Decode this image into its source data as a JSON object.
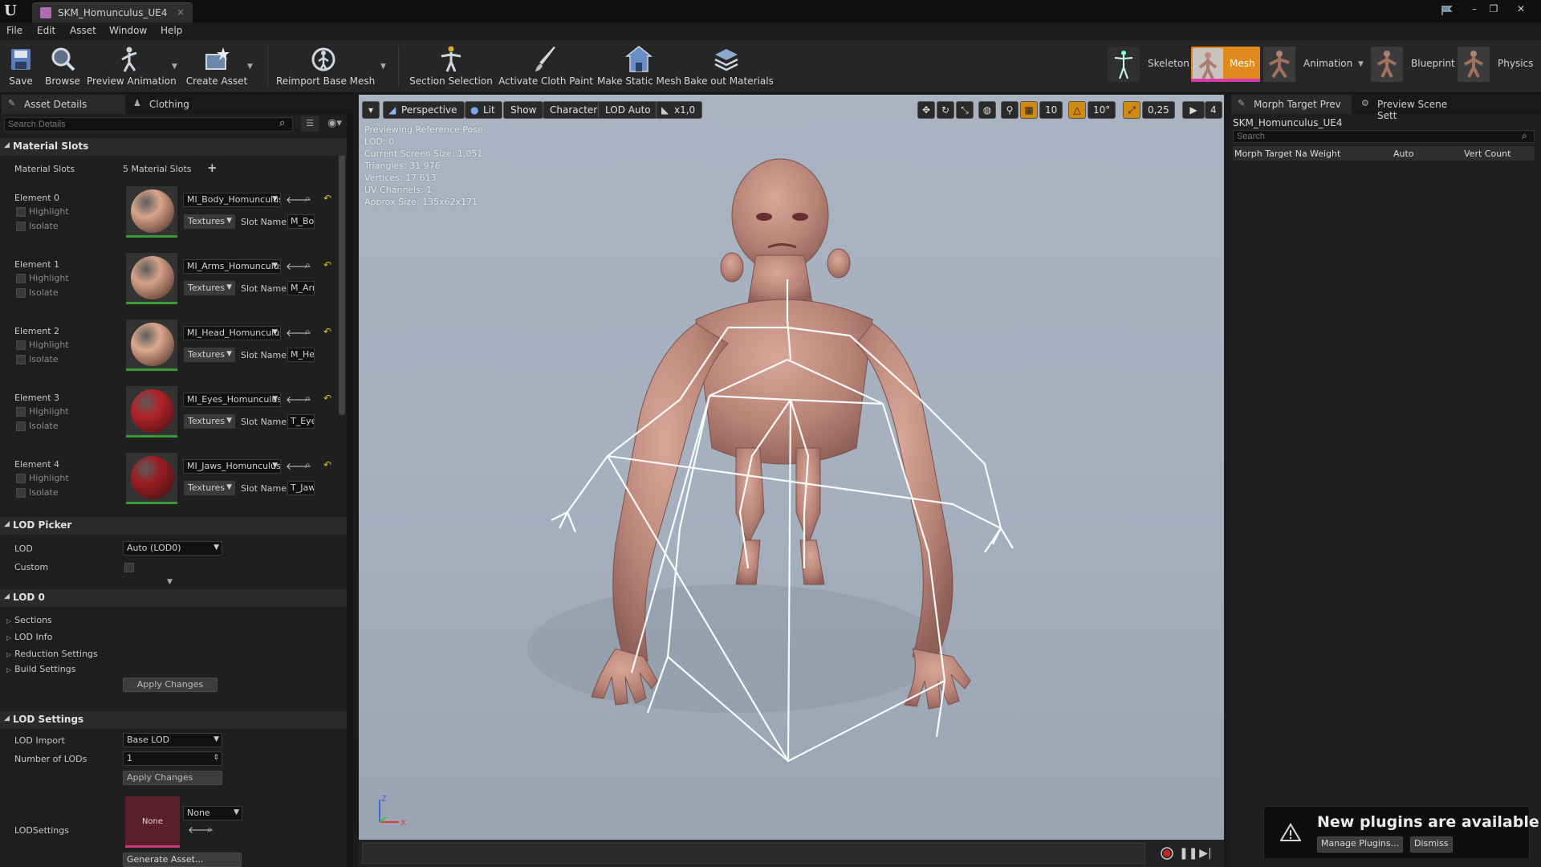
{
  "window": {
    "tab_title": "SKM_Homunculus_UE4",
    "tab_close": "×",
    "logo": "U",
    "controls": [
      "–",
      "❐",
      "✕"
    ],
    "flag_icon": "flag-icon"
  },
  "menu": [
    "File",
    "Edit",
    "Asset",
    "Window",
    "Help"
  ],
  "toolbar": {
    "buttons": [
      {
        "label": "Save",
        "icon": "save-icon"
      },
      {
        "label": "Browse",
        "icon": "browse-icon"
      },
      {
        "label": "Preview Animation",
        "icon": "preview-animation-icon"
      },
      {
        "label": "Create Asset",
        "icon": "create-asset-icon"
      },
      {
        "label": "Reimport Base Mesh",
        "icon": "reimport-icon"
      },
      {
        "label": "Section Selection",
        "icon": "section-selection-icon"
      },
      {
        "label": "Activate Cloth Paint",
        "icon": "cloth-paint-icon"
      },
      {
        "label": "Make Static Mesh",
        "icon": "static-mesh-icon"
      },
      {
        "label": "Bake out Materials",
        "icon": "bake-materials-icon"
      }
    ],
    "modes": [
      {
        "label": "Skeleton"
      },
      {
        "label": "Mesh",
        "active": true
      },
      {
        "label": "Animation"
      },
      {
        "label": "Blueprint"
      },
      {
        "label": "Physics"
      }
    ],
    "active_color": "#e08a1e"
  },
  "left_panel": {
    "tabs": [
      "Asset Details",
      "Clothing"
    ],
    "search_placeholder": "Search Details",
    "material_slots": {
      "header": "Material Slots",
      "label": "Material Slots",
      "count": "5 Material Slots",
      "add": "+",
      "highlight": "Highlight",
      "isolate": "Isolate",
      "textures": "Textures",
      "slot_name_label": "Slot Name",
      "elements": [
        {
          "name": "Element 0",
          "material": "MI_Body_Homunculus",
          "slot": "M_Body",
          "color": "#d8a58a"
        },
        {
          "name": "Element 1",
          "material": "MI_Arms_Homunculus",
          "slot": "M_Arms",
          "color": "#d6a288"
        },
        {
          "name": "Element 2",
          "material": "MI_Head_Homunculus",
          "slot": "M_Head",
          "color": "#dca98f"
        },
        {
          "name": "Element 3",
          "material": "MI_Eyes_Homunculus",
          "slot": "T_Eyes",
          "color": "#b3222a"
        },
        {
          "name": "Element 4",
          "material": "MI_Jaws_Homunculus",
          "slot": "T_Jaws",
          "color": "#9a1d22"
        }
      ]
    },
    "lod_picker": {
      "header": "LOD Picker",
      "lod_label": "LOD",
      "lod_value": "Auto (LOD0)",
      "custom_label": "Custom"
    },
    "lod0": {
      "header": "LOD 0",
      "items": [
        "Sections",
        "LOD Info",
        "Reduction Settings",
        "Build Settings"
      ],
      "apply": "Apply Changes"
    },
    "lod_settings": {
      "header": "LOD Settings",
      "lod_import_label": "LOD Import",
      "lod_import_value": "Base LOD",
      "num_lods_label": "Number of LODs",
      "num_lods_value": "1",
      "apply": "Apply Changes",
      "lodsettings_label": "LODSettings",
      "lodsettings_thumb": "None",
      "lodsettings_value": "None",
      "generate": "Generate Asset..."
    }
  },
  "viewport": {
    "menu_btn": "▾",
    "perspective": "Perspective",
    "lit": "Lit",
    "show": "Show",
    "character": "Character",
    "lod": "LOD Auto",
    "speed": "x1,0",
    "grid_snap": "10",
    "rot_snap": "10°",
    "scale_snap": "0,25",
    "cam_speed": "4",
    "stats": [
      "Previewing Reference Pose",
      "LOD: 0",
      "Current Screen Size: 1,051",
      "Triangles: 31 976",
      "Vertices: 17 613",
      "UV Channels: 1",
      "Approx Size: 135x62x171"
    ],
    "axis_z": "Z",
    "axis_x": "X",
    "bg_color": "#a8b2c1"
  },
  "right_panel": {
    "tabs": [
      "Morph Target Prev",
      "Preview Scene Sett"
    ],
    "mesh_name": "SKM_Homunculus_UE4",
    "search_placeholder": "Search",
    "columns": [
      "Morph Target Na",
      "Weight",
      "Auto",
      "Vert Count"
    ]
  },
  "notification": {
    "title": "New plugins are available",
    "manage": "Manage Plugins...",
    "dismiss": "Dismiss"
  }
}
